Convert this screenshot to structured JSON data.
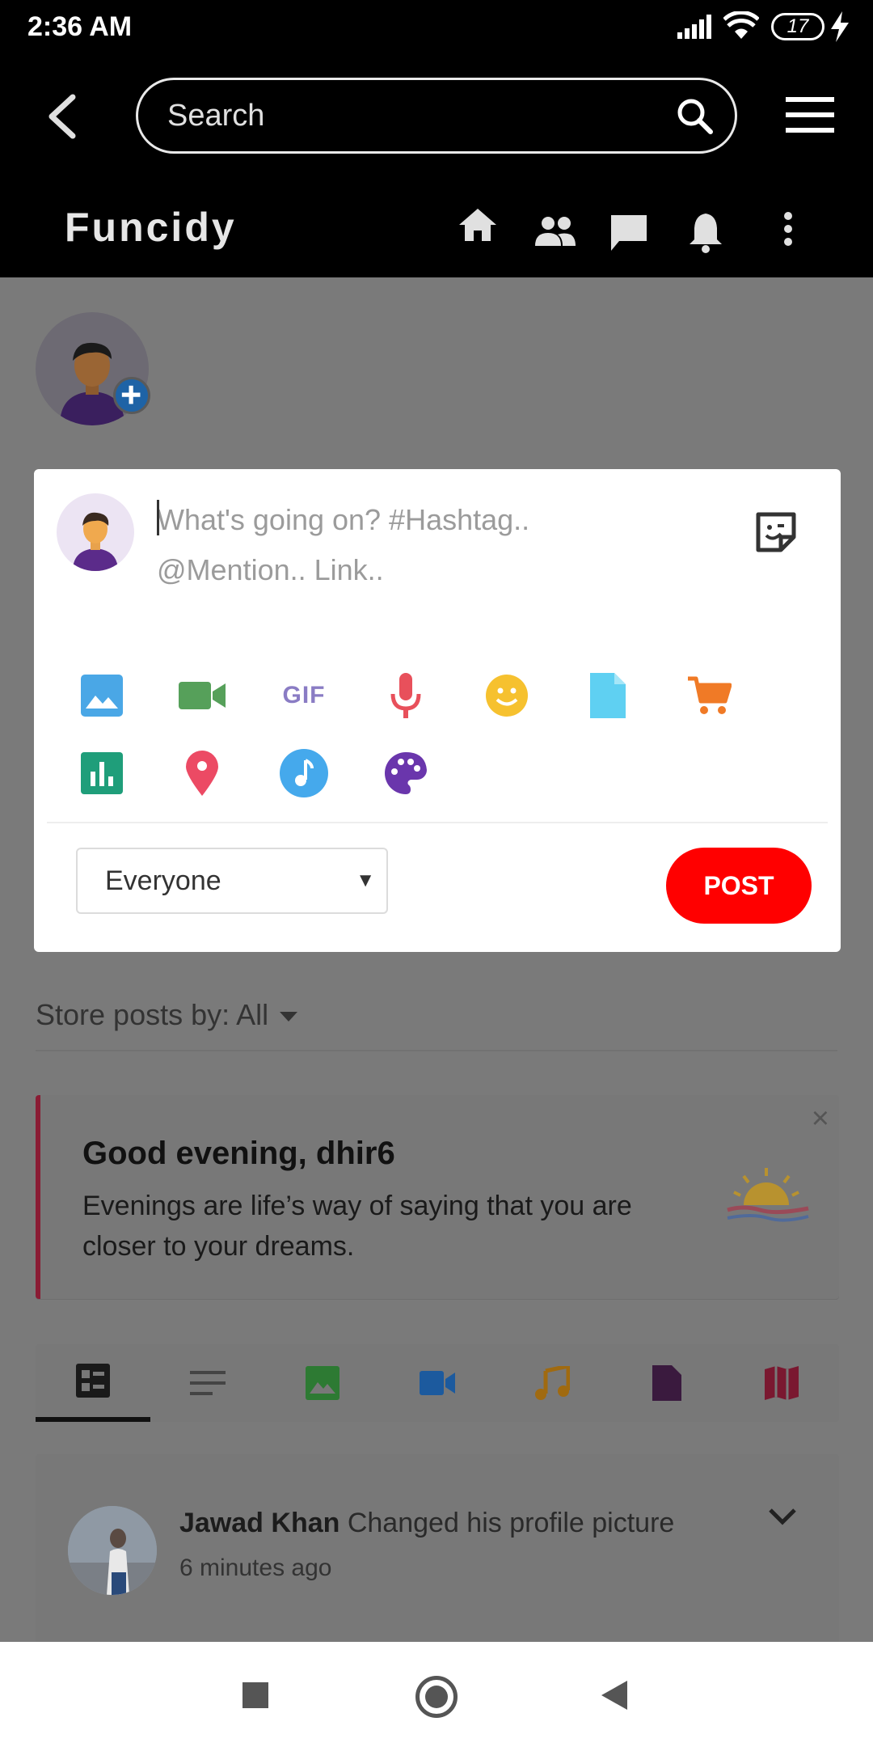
{
  "status_bar": {
    "time": "2:36 AM",
    "battery": "17"
  },
  "header": {
    "search_placeholder": "Search",
    "logo": "Funcidy"
  },
  "composer": {
    "placeholder": "What's going on? #Hashtag..\n@Mention.. Link..",
    "privacy_selected": "Everyone",
    "post_label": "POST",
    "tools": [
      "image-icon",
      "video-icon",
      "gif-icon",
      "microphone-icon",
      "emoji-icon",
      "file-icon",
      "cart-icon",
      "poll-icon",
      "location-icon",
      "music-icon",
      "palette-icon"
    ],
    "gif_label": "GIF"
  },
  "sort": {
    "label": "Store posts by: All"
  },
  "greeting": {
    "title": "Good evening, dhir6",
    "message": "Evenings are life’s way of saying that you are closer to your dreams.",
    "close": "×"
  },
  "filter_tabs": [
    "all-posts-icon",
    "text-icon",
    "photos-icon",
    "videos-icon",
    "music-icon",
    "files-icon",
    "maps-icon"
  ],
  "post": {
    "author": "Jawad Khan",
    "action": "Changed his profile picture",
    "time": "6 minutes ago"
  },
  "colors": {
    "post_button": "#ff0000",
    "greeting_accent": "#8a1c34"
  }
}
